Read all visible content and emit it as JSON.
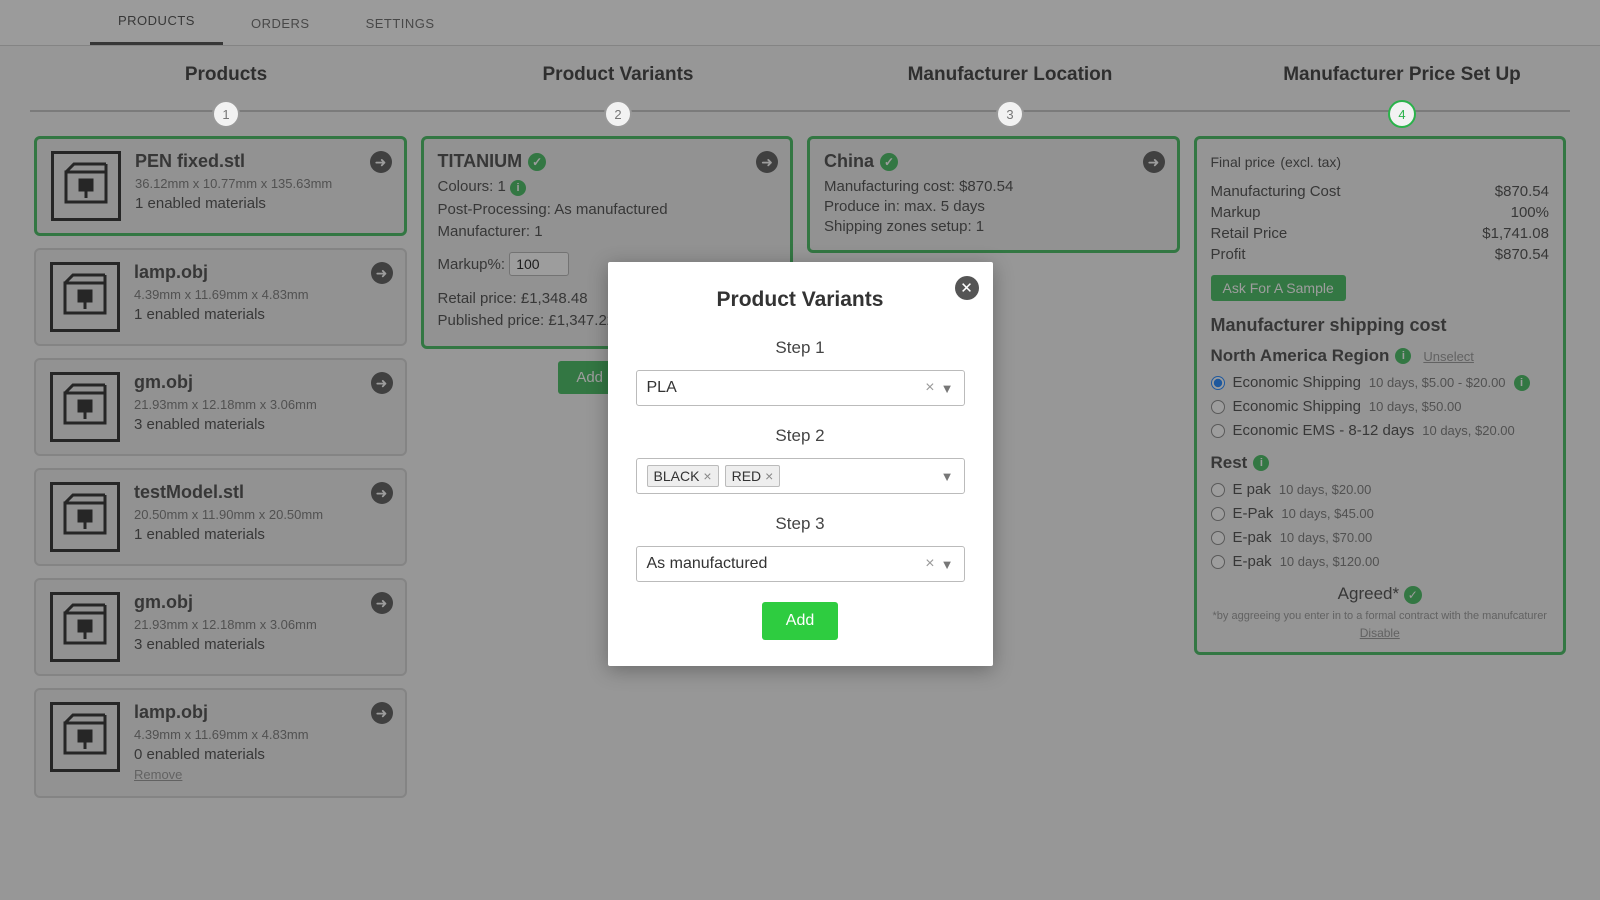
{
  "tabs": [
    "PRODUCTS",
    "ORDERS",
    "SETTINGS"
  ],
  "steps": [
    "Products",
    "Product Variants",
    "Manufacturer Location",
    "Manufacturer Price Set Up"
  ],
  "products": [
    {
      "name": "PEN fixed.stl",
      "dim": "36.12mm x 10.77mm x 135.63mm",
      "mat": "1 enabled materials",
      "sel": true
    },
    {
      "name": "lamp.obj",
      "dim": "4.39mm x 11.69mm x 4.83mm",
      "mat": "1 enabled materials"
    },
    {
      "name": "gm.obj",
      "dim": "21.93mm x 12.18mm x 3.06mm",
      "mat": "3 enabled materials"
    },
    {
      "name": "testModel.stl",
      "dim": "20.50mm x 11.90mm x 20.50mm",
      "mat": "1 enabled materials"
    },
    {
      "name": "gm.obj",
      "dim": "21.93mm x 12.18mm x 3.06mm",
      "mat": "3 enabled materials"
    },
    {
      "name": "lamp.obj",
      "dim": "4.39mm x 11.69mm x 4.83mm",
      "mat": "0 enabled materials",
      "remove": true
    }
  ],
  "variant": {
    "title": "TITANIUM",
    "colours": "Colours: 1",
    "post": "Post-Processing: As manufactured",
    "manu": "Manufacturer: 1",
    "markup_label": "Markup%:",
    "markup_value": "100",
    "retail": "Retail price: £1,348.48",
    "published": "Published price: £1,347.22",
    "add_new": "Add New"
  },
  "location": {
    "title": "China",
    "cost": "Manufacturing cost: $870.54",
    "produce": "Produce in: max. 5 days",
    "zones": "Shipping zones setup: 1"
  },
  "price": {
    "title": "Final price",
    "title_sub": "(excl. tax)",
    "rows": [
      [
        "Manufacturing Cost",
        "$870.54"
      ],
      [
        "Markup",
        "100%"
      ],
      [
        "Retail Price",
        "$1,741.08"
      ],
      [
        "Profit",
        "$870.54"
      ]
    ],
    "ask": "Ask For A Sample",
    "ship_title": "Manufacturer shipping cost",
    "region1": "North America Region",
    "unselect": "Unselect",
    "ship1": [
      {
        "name": "Economic Shipping",
        "meta": "10 days, $5.00 - $20.00",
        "checked": true,
        "info": true
      },
      {
        "name": "Economic Shipping",
        "meta": "10 days, $50.00"
      },
      {
        "name": "Economic EMS - 8-12 days",
        "meta": "10 days, $20.00"
      }
    ],
    "region2": "Rest",
    "ship2": [
      {
        "name": "E pak",
        "meta": "10 days, $20.00"
      },
      {
        "name": "E-Pak",
        "meta": "10 days, $45.00"
      },
      {
        "name": "E-pak",
        "meta": "10 days, $70.00"
      },
      {
        "name": "E-pak",
        "meta": "10 days, $120.00"
      }
    ],
    "agreed": "Agreed*",
    "foot": "*by aggreeing you enter in to a formal contract with the manufcaturer",
    "disable": "Disable"
  },
  "modal": {
    "title": "Product Variants",
    "step1": "Step 1",
    "sel1": "PLA",
    "step2": "Step 2",
    "chips": [
      "BLACK",
      "RED"
    ],
    "step3": "Step 3",
    "sel3": "As manufactured",
    "add": "Add"
  }
}
